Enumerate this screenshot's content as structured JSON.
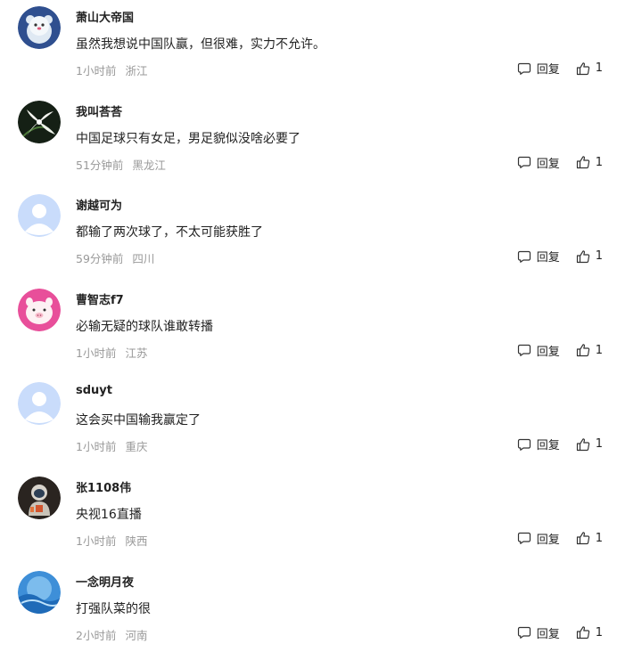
{
  "comments": [
    {
      "username": "萧山大帝国",
      "content": "虽然我想说中国队赢，但很难，实力不允许。",
      "time": "1小时前",
      "location": "浙江",
      "reply_label": "回复",
      "likes": "1",
      "avatar": "cartoon-bear-avatar"
    },
    {
      "username": "我叫荅荅",
      "content": "中国足球只有女足，男足貌似没啥必要了",
      "time": "51分钟前",
      "location": "黑龙江",
      "reply_label": "回复",
      "likes": "1",
      "avatar": "white-flower-avatar"
    },
    {
      "username": "谢越可为",
      "content": "都输了两次球了，不太可能获胜了",
      "time": "59分钟前",
      "location": "四川",
      "reply_label": "回复",
      "likes": "1",
      "avatar": "default-user-avatar"
    },
    {
      "username": "曹智志f7",
      "content": "必输无疑的球队谁敢转播",
      "time": "1小时前",
      "location": "江苏",
      "reply_label": "回复",
      "likes": "1",
      "avatar": "cartoon-pig-avatar"
    },
    {
      "username": "sduyt",
      "content": "这会买中国输我赢定了",
      "time": "1小时前",
      "location": "重庆",
      "reply_label": "回复",
      "likes": "1",
      "avatar": "default-user-avatar"
    },
    {
      "username": "张1108伟",
      "content": "央视16直播",
      "time": "1小时前",
      "location": "陕西",
      "reply_label": "回复",
      "likes": "1",
      "avatar": "astronaut-avatar"
    },
    {
      "username": "一念明月夜",
      "content": "打强队菜的很",
      "time": "2小时前",
      "location": "河南",
      "reply_label": "回复",
      "likes": "1",
      "avatar": "blue-ocean-avatar"
    }
  ]
}
